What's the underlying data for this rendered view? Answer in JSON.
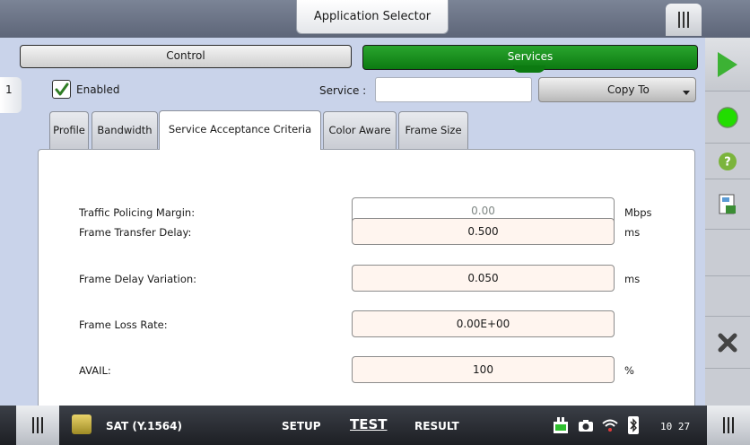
{
  "header": {
    "app_title": "Application Selector"
  },
  "modes": {
    "control_label": "Control",
    "services_label": "Services"
  },
  "service_row": {
    "number": "1",
    "enabled_label": "Enabled",
    "enabled_checked": true,
    "service_label": "Service :",
    "service_value": "",
    "copy_to_label": "Copy To"
  },
  "tabs": [
    {
      "label": "Profile"
    },
    {
      "label": "Bandwidth"
    },
    {
      "label": "Service Acceptance Criteria",
      "active": true
    },
    {
      "label": "Color Aware"
    },
    {
      "label": "Frame Size"
    }
  ],
  "fields": [
    {
      "label": "Traffic Policing Margin:",
      "value": "0.00",
      "unit": "Mbps"
    },
    {
      "label": "Frame Transfer Delay:",
      "value": "0.500",
      "unit": "ms"
    },
    {
      "label": "Frame Delay Variation:",
      "value": "0.050",
      "unit": "ms"
    },
    {
      "label": "Frame Loss Rate:",
      "value": "0.00E+00",
      "unit": ""
    },
    {
      "label": "AVAIL:",
      "value": "100",
      "unit": "%"
    }
  ],
  "bottom": {
    "test_name": "SAT (Y.1564)",
    "setup_label": "SETUP",
    "test_label": "TEST",
    "result_label": "RESULT",
    "clock": "10 27"
  },
  "icons": {
    "right_toolbar": [
      "play-icon",
      "status-led-icon",
      "help-icon",
      "report-icon",
      "close-icon"
    ],
    "status": [
      "power-plug-icon",
      "camera-icon",
      "wifi-icon",
      "bluetooth-icon"
    ]
  },
  "colors": {
    "accent_green": "#1e9a22",
    "panel_bg": "#c9d3ea",
    "field_bg": "#fff5ef"
  }
}
